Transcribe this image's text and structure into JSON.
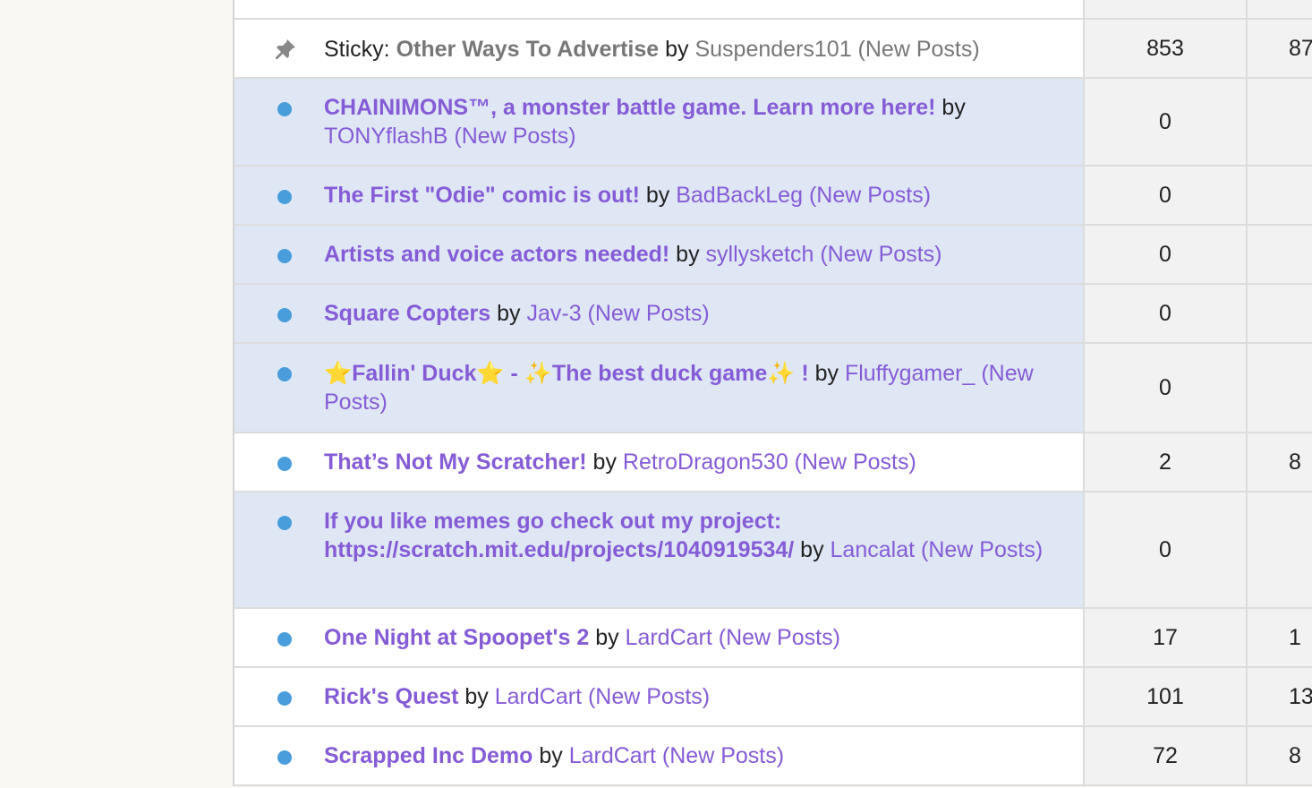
{
  "topics": [
    {
      "prefix": "",
      "title": "",
      "by": "",
      "author": "",
      "new_posts": "",
      "replies": "",
      "views": ""
    },
    {
      "prefix": "Sticky: ",
      "title": "Other Ways To Advertise",
      "by": " by ",
      "author": "Suspenders101",
      "new_posts": " (New Posts)",
      "replies": "853",
      "views": "87"
    },
    {
      "prefix": "",
      "title": "CHAINIMONS™, a monster battle game. Learn more here!",
      "by": " by ",
      "author": "TONYflashB",
      "new_posts": " (New Posts)",
      "replies": "0",
      "views": ""
    },
    {
      "prefix": "",
      "title": "The First \"Odie\" comic is out!",
      "by": " by ",
      "author": "BadBackLeg",
      "new_posts": " (New Posts)",
      "replies": "0",
      "views": ""
    },
    {
      "prefix": "",
      "title": "Artists and voice actors needed!",
      "by": " by ",
      "author": "syllysketch",
      "new_posts": " (New Posts)",
      "replies": "0",
      "views": ""
    },
    {
      "prefix": "",
      "title": "Square Copters",
      "by": " by ",
      "author": "Jav-3",
      "new_posts": " (New Posts)",
      "replies": "0",
      "views": ""
    },
    {
      "prefix": "",
      "title": "⭐Fallin' Duck⭐ - ✨The best duck game✨ !",
      "by": " by ",
      "author": "Fluffygamer_",
      "new_posts": " (New Posts)",
      "replies": "0",
      "views": ""
    },
    {
      "prefix": "",
      "title": "That’s Not My Scratcher!",
      "by": " by ",
      "author": "RetroDragon530",
      "new_posts": " (New Posts)",
      "replies": "2",
      "views": "8"
    },
    {
      "prefix": "",
      "title": "If you like memes go check out my project: https://scratch.mit.edu/projects/1040919534/",
      "by": " by ",
      "author": "Lancalat",
      "new_posts": " (New Posts)",
      "replies": "0",
      "views": ""
    },
    {
      "prefix": "",
      "title": "One Night at Spoopet's 2",
      "by": " by ",
      "author": "LardCart",
      "new_posts": " (New Posts)",
      "replies": "17",
      "views": "1"
    },
    {
      "prefix": "",
      "title": "Rick's Quest",
      "by": " by ",
      "author": "LardCart",
      "new_posts": " (New Posts)",
      "replies": "101",
      "views": "13"
    },
    {
      "prefix": "",
      "title": "Scrapped Inc Demo",
      "by": " by ",
      "author": "LardCart",
      "new_posts": " (New Posts)",
      "replies": "72",
      "views": "8"
    }
  ],
  "colors": {
    "link": "#855cd6",
    "unread_row": "#dfe7f5",
    "read_row": "#ffffff",
    "dot": "#4a9ddb"
  }
}
